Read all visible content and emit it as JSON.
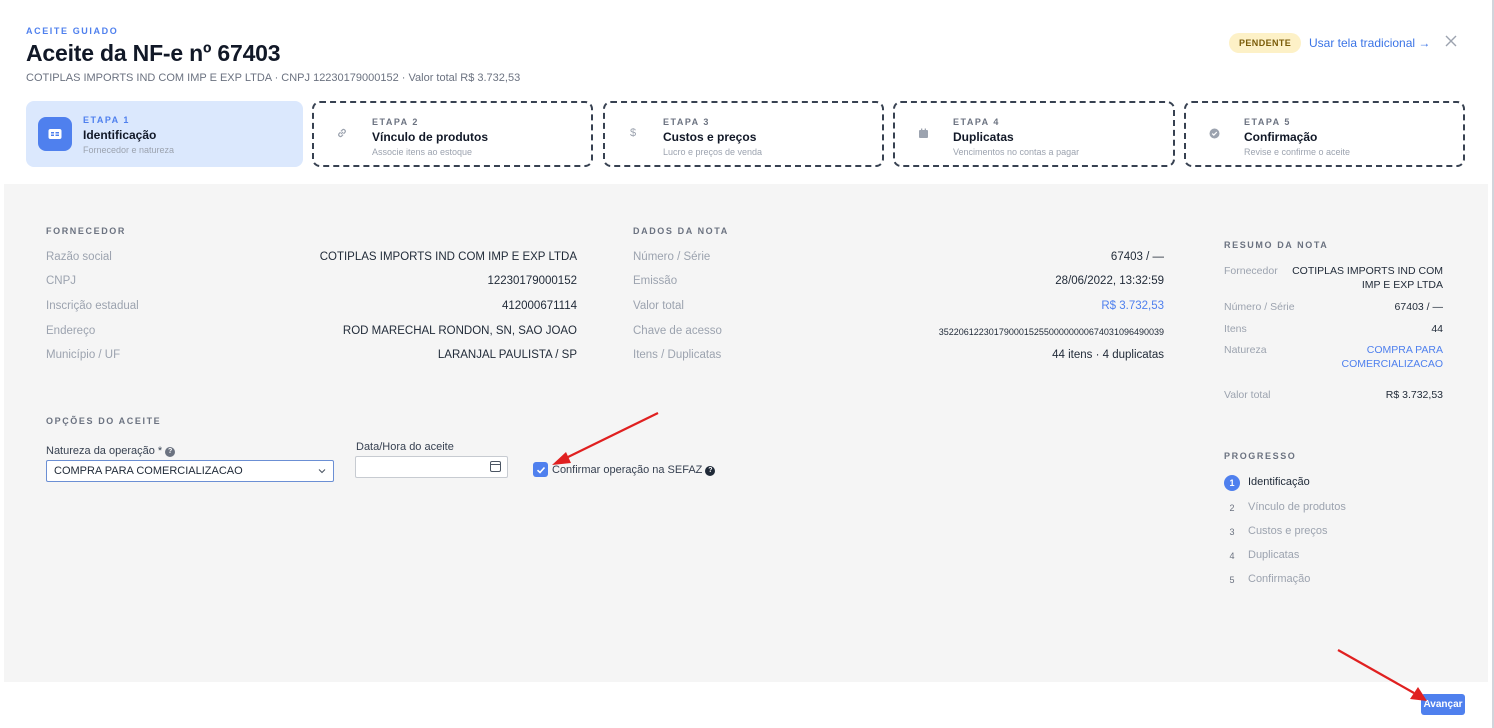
{
  "header": {
    "eyebrow": "ACEITE GUIADO",
    "title": "Aceite da NF-e nº 67403",
    "subtitle": "COTIPLAS IMPORTS IND COM IMP E EXP LTDA · CNPJ 12230179000152 · Valor total R$ 3.732,53",
    "status_badge": "PENDENTE",
    "traditional_link": "Usar tela tradicional →",
    "close_icon": "close-icon"
  },
  "steps": [
    {
      "eyebrow": "ETAPA 1",
      "name": "Identificação",
      "desc": "Fornecedor e natureza",
      "icon": "id-card-icon"
    },
    {
      "eyebrow": "ETAPA 2",
      "name": "Vínculo de produtos",
      "desc": "Associe itens ao estoque",
      "icon": "link-icon"
    },
    {
      "eyebrow": "ETAPA 3",
      "name": "Custos e preços",
      "desc": "Lucro e preços de venda",
      "icon": "dollar-icon"
    },
    {
      "eyebrow": "ETAPA 4",
      "name": "Duplicatas",
      "desc": "Vencimentos no contas a pagar",
      "icon": "calendar-icon"
    },
    {
      "eyebrow": "ETAPA 5",
      "name": "Confirmação",
      "desc": "Revise e confirme o aceite",
      "icon": "check-circle-icon"
    }
  ],
  "fornecedor": {
    "heading": "FORNECEDOR",
    "rows": [
      {
        "label": "Razão social",
        "value": "COTIPLAS IMPORTS IND COM IMP E EXP LTDA"
      },
      {
        "label": "CNPJ",
        "value": "12230179000152"
      },
      {
        "label": "Inscrição estadual",
        "value": "412000671114"
      },
      {
        "label": "Endereço",
        "value": "ROD MARECHAL RONDON, SN, SAO JOAO"
      },
      {
        "label": "Município / UF",
        "value": "LARANJAL PAULISTA / SP"
      }
    ]
  },
  "dados_nota": {
    "heading": "DADOS DA NOTA",
    "rows": [
      {
        "label": "Número / Série",
        "value": "67403 / —"
      },
      {
        "label": "Emissão",
        "value": "28/06/2022, 13:32:59"
      },
      {
        "label": "Valor total",
        "value": "R$ 3.732,53"
      },
      {
        "label": "Chave de acesso",
        "value": "35220612230179000152550000000067403109649003­9"
      },
      {
        "label": "Itens / Duplicatas",
        "value": "44 itens · 4 duplicatas"
      }
    ]
  },
  "opcoes": {
    "heading": "OPÇÕES DO ACEITE",
    "natureza_label": "Natureza da operação *",
    "natureza_value": "COMPRA PARA COMERCIALIZACAO",
    "data_label": "Data/Hora do aceite",
    "data_value": "",
    "sefaz_label": "Confirmar operação na SEFAZ",
    "sefaz_checked": true
  },
  "resumo": {
    "heading": "RESUMO DA NOTA",
    "fornecedor_label": "Fornecedor",
    "fornecedor_value_1": "COTIPLAS IMPORTS IND COM",
    "fornecedor_value_2": "IMP E EXP LTDA",
    "numero_label": "Número / Série",
    "numero_value": "67403 / —",
    "itens_label": "Itens",
    "itens_value": "44",
    "natureza_label": "Natureza",
    "natureza_value_1": "COMPRA PARA",
    "natureza_value_2": "COMERCIALIZACAO",
    "valor_label": "Valor total",
    "valor_value": "R$ 3.732,53"
  },
  "progresso": {
    "heading": "PROGRESSO",
    "items": [
      {
        "num": "1",
        "label": "Identificação"
      },
      {
        "num": "2",
        "label": "Vínculo de produtos"
      },
      {
        "num": "3",
        "label": "Custos e preços"
      },
      {
        "num": "4",
        "label": "Duplicatas"
      },
      {
        "num": "5",
        "label": "Confirmação"
      }
    ]
  },
  "footer": {
    "next_label": "Avançar"
  },
  "colors": {
    "accent": "#4f80ee",
    "badge_bg": "#fdf1c7",
    "annotation_arrow": "#e02020"
  }
}
